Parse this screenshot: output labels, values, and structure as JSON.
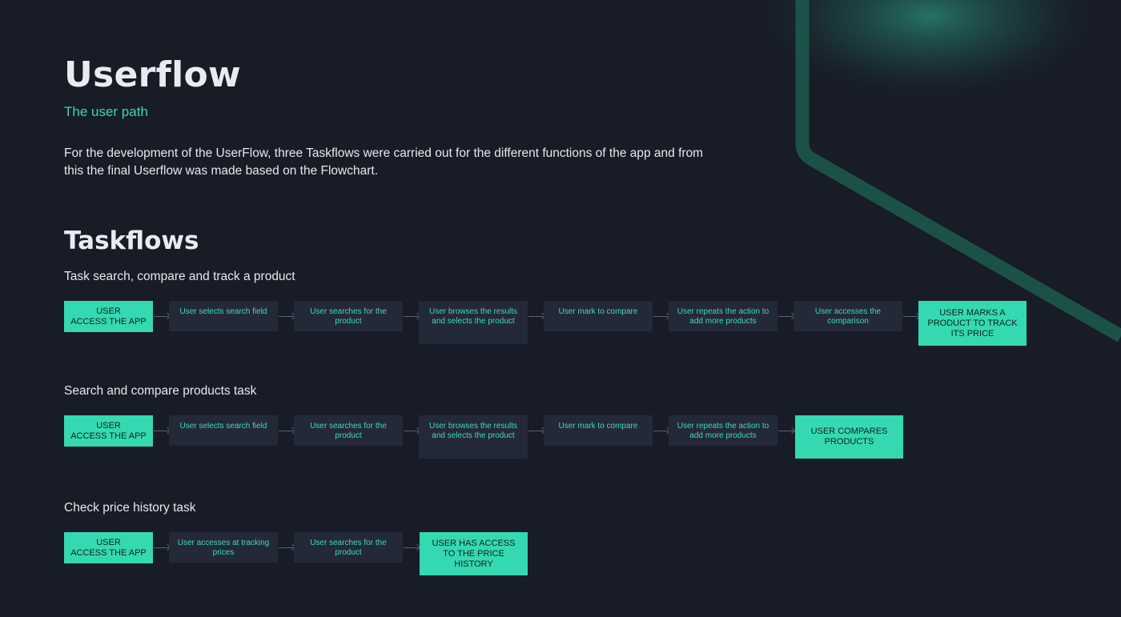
{
  "colors": {
    "background": "#181c27",
    "accent": "#34d9b1",
    "step_box": "#242938",
    "step_text": "#3ddbb2",
    "connector": "#5a6070"
  },
  "header": {
    "title": "Userflow",
    "subtitle": "The user path",
    "intro": "For the development of the UserFlow, three Taskflows were carried out for the different functions of the app and from this the final Userflow was made based on the Flowchart."
  },
  "taskflows": {
    "title": "Taskflows",
    "flows": [
      {
        "title": "Task search, compare and track a product",
        "start": "USER\nACCESS THE APP",
        "steps": [
          "User selects search field",
          "User searches for the product",
          "User browses the results and selects the product",
          "User mark to compare",
          "User repeats the action to add more products",
          "User accesses the comparison"
        ],
        "end": "USER MARKS A PRODUCT TO TRACK ITS PRICE"
      },
      {
        "title": "Search and compare products task",
        "start": "USER\nACCESS THE APP",
        "steps": [
          "User selects search field",
          "User searches for the product",
          "User browses the results and selects the product",
          "User mark to compare",
          "User repeats the action to add more products"
        ],
        "end": "USER COMPARES PRODUCTS"
      },
      {
        "title": "Check price history task",
        "start": "USER\nACCESS THE APP",
        "steps": [
          "User accesses at tracking prices",
          "User searches for the product"
        ],
        "end": "USER HAS ACCESS TO THE PRICE HISTORY"
      }
    ]
  }
}
